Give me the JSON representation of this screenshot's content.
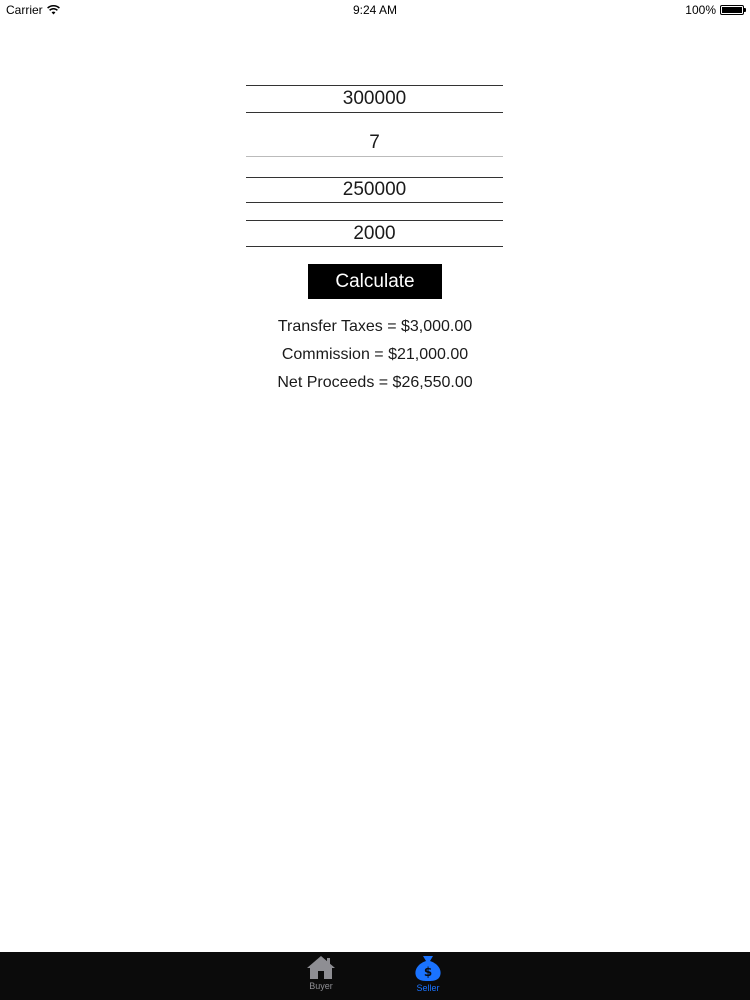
{
  "status_bar": {
    "carrier": "Carrier",
    "time": "9:24 AM",
    "battery": "100%"
  },
  "form": {
    "fields": [
      {
        "value": "300000"
      },
      {
        "value": "7"
      },
      {
        "value": "250000"
      },
      {
        "value": "2000"
      }
    ],
    "button_label": "Calculate"
  },
  "results": {
    "transfer_taxes": "Transfer Taxes = $3,000.00",
    "commission": "Commission = $21,000.00",
    "net_proceeds": "Net Proceeds = $26,550.00"
  },
  "tab_bar": {
    "tabs": [
      {
        "label": "Buyer",
        "icon": "house-icon",
        "color": "#8e8e93",
        "selected": false
      },
      {
        "label": "Seller",
        "icon": "money-bag-icon",
        "color": "#1a73ff",
        "selected": true
      }
    ]
  }
}
